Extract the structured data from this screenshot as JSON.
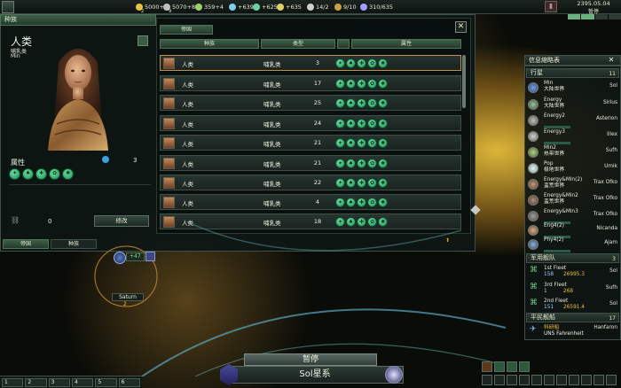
{
  "topbar": {
    "resources": [
      {
        "value": "5000+5",
        "sub": "2",
        "color": "#e9c23a"
      },
      {
        "value": "5070+83",
        "sub": "9",
        "color": "#c0c0c0"
      },
      {
        "value": "359+4",
        "sub": "",
        "color": "#9ad16a"
      },
      {
        "value": "+639",
        "sub": "",
        "color": "#7ed0e6"
      },
      {
        "value": "+625",
        "sub": "",
        "color": "#6ad0a0"
      },
      {
        "value": "+635",
        "sub": "",
        "color": "#e0d060"
      },
      {
        "value": "14/2",
        "sub": "",
        "color": "#d0d0d0"
      },
      {
        "value": "9/10",
        "sub": "",
        "color": "#d0a040"
      },
      {
        "value": "310/635",
        "sub": "",
        "color": "#a0a0ff"
      }
    ],
    "date": "2395.05.04",
    "paused_label": "暂停"
  },
  "species_panel": {
    "title": "种族",
    "species_name": "人类",
    "species_class": "哺乳类",
    "portrait_name": "Min",
    "attributes_label": "属性",
    "attributes_count": "3",
    "pops_count": "0",
    "modify_button": "修改",
    "bottom_tabs": [
      "帝国",
      "种族"
    ],
    "list_tab": "帝国",
    "columns": [
      "种族",
      "类型",
      "属性"
    ],
    "rows": [
      {
        "name": "人类",
        "type": "哺乳类",
        "count": "3"
      },
      {
        "name": "人类",
        "type": "哺乳类",
        "count": "17"
      },
      {
        "name": "人类",
        "type": "哺乳类",
        "count": "25"
      },
      {
        "name": "人类",
        "type": "哺乳类",
        "count": "24"
      },
      {
        "name": "人类",
        "type": "哺乳类",
        "count": "21"
      },
      {
        "name": "人类",
        "type": "哺乳类",
        "count": "21"
      },
      {
        "name": "人类",
        "type": "哺乳类",
        "count": "22"
      },
      {
        "name": "人类",
        "type": "哺乳类",
        "count": "4"
      },
      {
        "name": "人类",
        "type": "哺乳类",
        "count": "18"
      }
    ]
  },
  "outliner": {
    "title": "信息縮略表",
    "planets_label": "行星",
    "planets_count": "11",
    "planets": [
      {
        "name": "Min",
        "region": "大陆世界",
        "system": "Sol"
      },
      {
        "name": "Energy",
        "region": "大陆世界",
        "system": "Sirius"
      },
      {
        "name": "Energy2",
        "region": "",
        "system": "Asterion"
      },
      {
        "name": "Energy3",
        "region": "",
        "system": "Illex"
      },
      {
        "name": "Min2",
        "region": "热带世界",
        "system": "Sufh"
      },
      {
        "name": "Pop",
        "region": "极地世界",
        "system": "Umik"
      },
      {
        "name": "Energy&Min(2)",
        "region": "蛮荒世界",
        "system": "Trax Ofko"
      },
      {
        "name": "Energy&Min2",
        "region": "蛮荒世界",
        "system": "Trax Ofko"
      },
      {
        "name": "Energy&Min3",
        "region": "",
        "system": "Trax Ofko"
      },
      {
        "name": "Eng4(2)",
        "region": "",
        "system": "Nicanda"
      },
      {
        "name": "Phy4(2)",
        "region": "",
        "system": "Ajam"
      }
    ],
    "fleets_label": "军用舰队",
    "fleets_count": "3",
    "fleets": [
      {
        "name": "1st Fleet",
        "ships": "158",
        "power": "26995.3",
        "system": "Sol"
      },
      {
        "name": "3rd Fleet",
        "ships": "1",
        "power": "268",
        "system": "Sufh"
      },
      {
        "name": "2nd Fleet",
        "ships": "151",
        "power": "26591.4",
        "system": "Sol"
      }
    ],
    "civilian_label": "平民舰船",
    "civilian_count": "17",
    "civilian_item": "科研船",
    "civilian_ship": "UNS Fahrenheit",
    "civilian_system": "Hanfaron"
  },
  "map": {
    "planet_label": "Saturn",
    "planet_badge": "+47",
    "planet_count": "2"
  },
  "bottom": {
    "pause_banner": "暂停",
    "system_name": "Sol星系",
    "left_buttons": [
      "1",
      "2",
      "3",
      "4",
      "5",
      "6"
    ]
  },
  "colors": {
    "accent_green": "#4f7356",
    "trait_green": "#1e8f58",
    "panel_bg": "#0e1614"
  }
}
